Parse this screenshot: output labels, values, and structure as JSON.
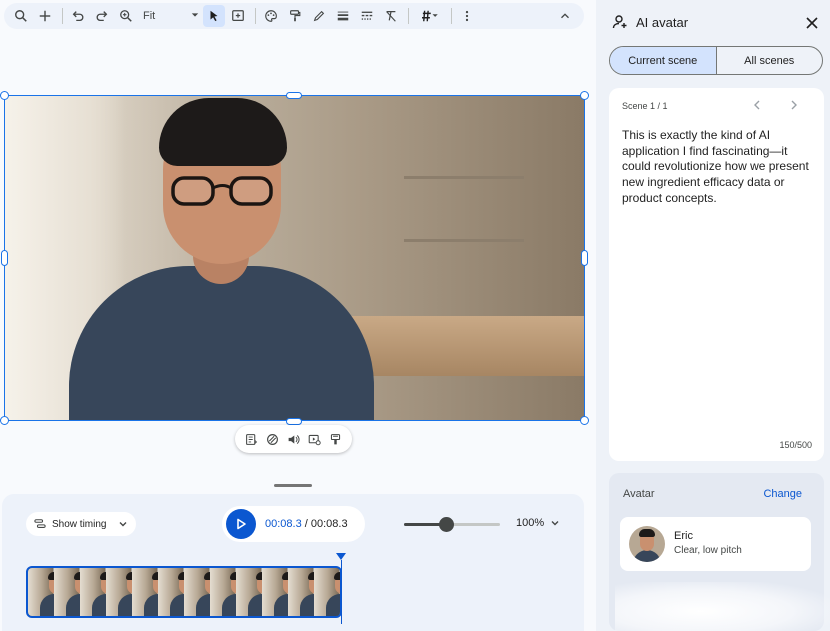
{
  "toolbar": {
    "zoom_label": "Fit",
    "icons": [
      "search-icon",
      "add-icon",
      "undo-icon",
      "redo-icon",
      "zoom-icon",
      "select-icon",
      "add-box-icon",
      "palette-icon",
      "paint-format-icon",
      "pen-icon",
      "border-weight-icon",
      "border-dash-icon",
      "clear-format-icon",
      "grid-icon",
      "more-icon",
      "collapse-icon"
    ]
  },
  "floating_toolbar": {
    "icons": [
      "script-icon",
      "style-icon",
      "volume-icon",
      "media-icon",
      "transition-icon"
    ]
  },
  "timeline": {
    "show_timing_label": "Show timing",
    "current_time": "00:08.3",
    "separator": " / ",
    "total_time": "00:08.3",
    "zoom_fraction": 0.44,
    "zoom_percent": "100%",
    "thumbnail_count": 12
  },
  "panel": {
    "title": "AI avatar",
    "tabs": [
      {
        "label": "Current scene",
        "selected": true
      },
      {
        "label": "All scenes",
        "selected": false
      }
    ],
    "scene_label": "Scene 1 / 1",
    "script": "This is exactly the kind of AI application I find fascinating—it could revolutionize how we present new ingredient efficacy data or product concepts.",
    "char_count": "150/500",
    "avatar_section_label": "Avatar",
    "change_label": "Change",
    "avatar_name": "Eric",
    "avatar_desc": "Clear, low pitch"
  },
  "colors": {
    "accent": "#0b57d0",
    "selection": "#1a73e8",
    "tab_selected_bg": "#d3e3fd"
  }
}
